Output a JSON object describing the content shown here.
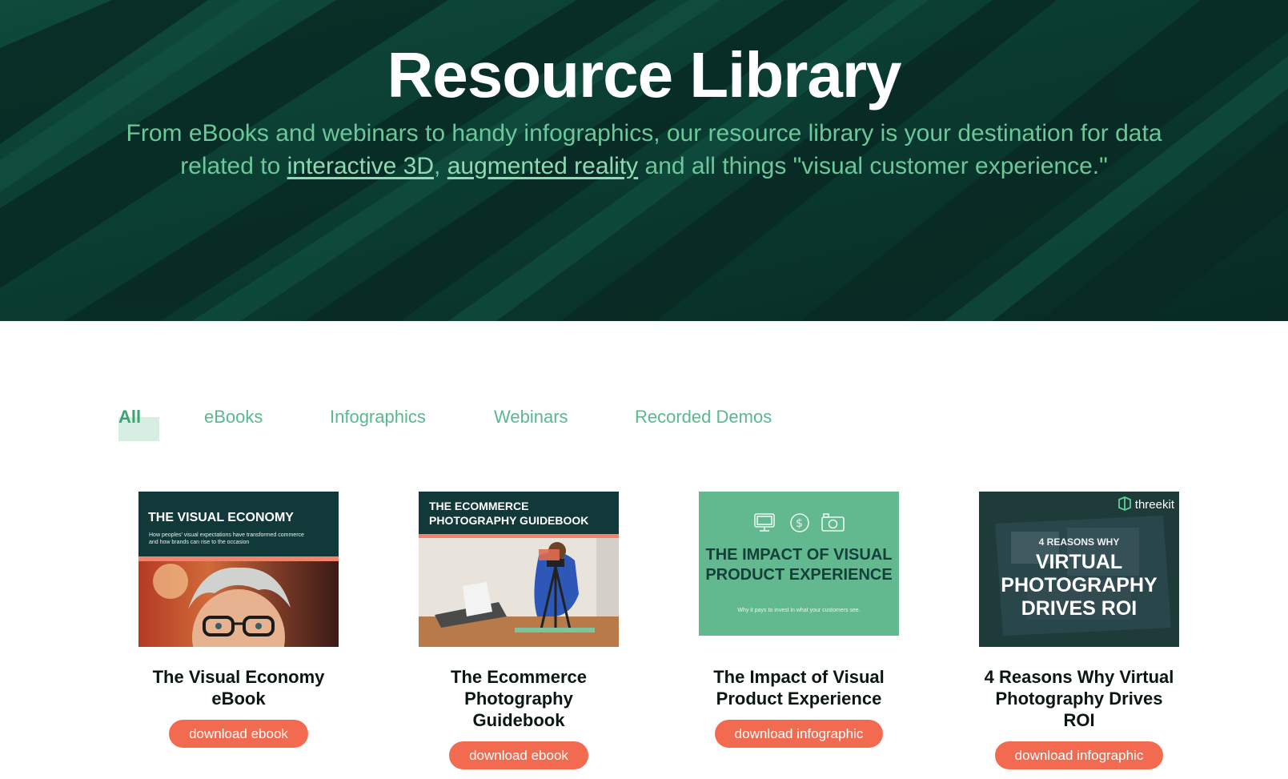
{
  "hero": {
    "title": "Resource Library",
    "subtitle_part1": "From eBooks and webinars to handy infographics, our resource library is your destination for data related to ",
    "link_interactive_3d": "interactive 3D",
    "comma": ", ",
    "link_augmented_reality": "augmented reality",
    "subtitle_part2": " and all things \"visual customer experience.\""
  },
  "filters": [
    {
      "label": "All",
      "active": true
    },
    {
      "label": "eBooks",
      "active": false
    },
    {
      "label": "Infographics",
      "active": false
    },
    {
      "label": "Webinars",
      "active": false
    },
    {
      "label": "Recorded Demos",
      "active": false
    }
  ],
  "cards": [
    {
      "title": "The Visual Economy eBook",
      "button": "download ebook",
      "thumb": {
        "heading": "THE VISUAL ECONOMY",
        "subheading": "How peoples' visual expectations have transformed commerce and how brands can rise to the occasion"
      }
    },
    {
      "title": "The Ecommerce Photography Guidebook",
      "button": "download ebook",
      "thumb": {
        "heading": "THE ECOMMERCE PHOTOGRAPHY GUIDEBOOK"
      }
    },
    {
      "title": "The Impact of Visual Product Experience",
      "button": "download infographic",
      "thumb": {
        "heading": "THE IMPACT OF VISUAL PRODUCT EXPERIENCE",
        "subheading": "Why it pays to invest in what your customers see.",
        "icons": [
          "monitor-icon",
          "dollar-icon",
          "camera-icon"
        ]
      }
    },
    {
      "title": "4 Reasons Why Virtual Photography Drives ROI",
      "button": "download infographic",
      "thumb": {
        "brand": "threekit",
        "kicker": "4 REASONS WHY",
        "heading": "VIRTUAL PHOTOGRAPHY DRIVES ROI"
      }
    }
  ],
  "colors": {
    "hero_bg": "#0b3a30",
    "hero_subtitle": "#6cc79a",
    "filter_text": "#59b98d",
    "button_bg": "#f26a4f"
  }
}
